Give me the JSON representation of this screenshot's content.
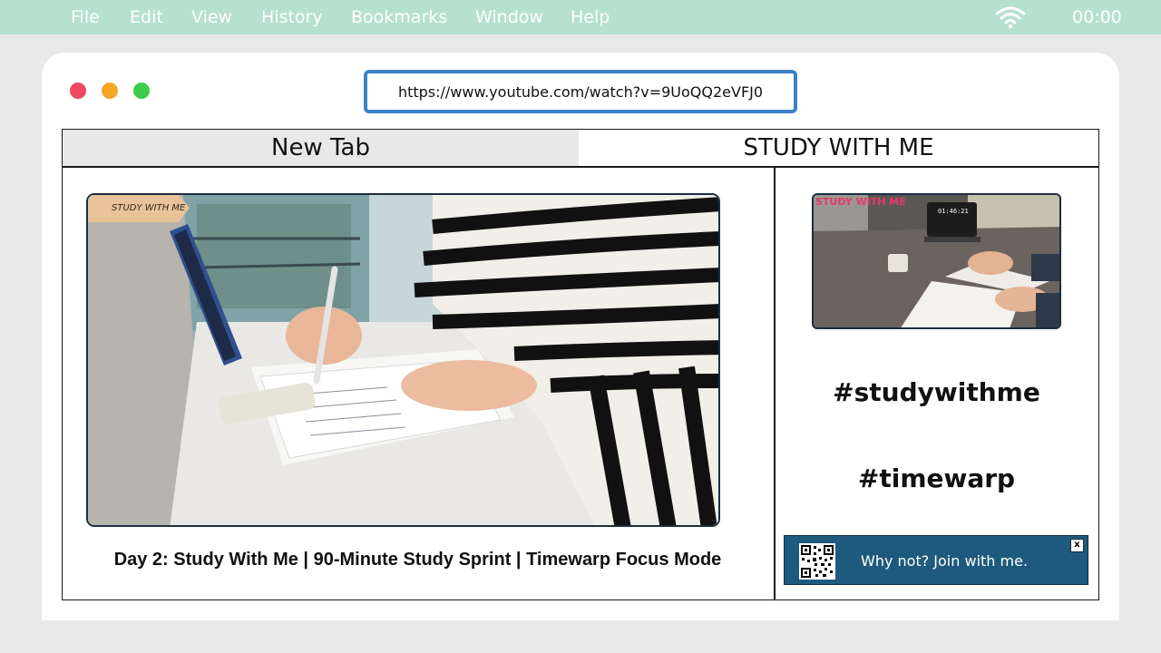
{
  "menubar": {
    "items": [
      "File",
      "Edit",
      "View",
      "History",
      "Bookmarks",
      "Window",
      "Help"
    ],
    "clock": "00:00",
    "wifi_icon": "wifi-icon"
  },
  "window": {
    "traffic_lights": [
      "close-icon",
      "minimize-icon",
      "zoom-icon"
    ],
    "url": "https://www.youtube.com/watch?v=9UoQQ2eVFJ0"
  },
  "tabs": [
    {
      "label": "New Tab",
      "active": false
    },
    {
      "label": "STUDY WITH ME",
      "active": true
    }
  ],
  "main": {
    "video_badge": "STUDY WITH ME",
    "video_title": "Day 2: Study With Me | 90-Minute Study Sprint | Timewarp Focus Mode"
  },
  "side": {
    "thumb_badge": "STUDY WITH ME",
    "thumb_clock": "01:46:21",
    "hashtags": [
      "#studywithme",
      "#timewarp"
    ],
    "banner_text": "Why not? Join with me.",
    "banner_close": "x"
  },
  "colors": {
    "menubar": "#b6e0cf",
    "url_border": "#3b82c6",
    "banner": "#1e5a7d",
    "red": "#ef4861",
    "yellow": "#f5a623",
    "green": "#3dcc4a"
  }
}
